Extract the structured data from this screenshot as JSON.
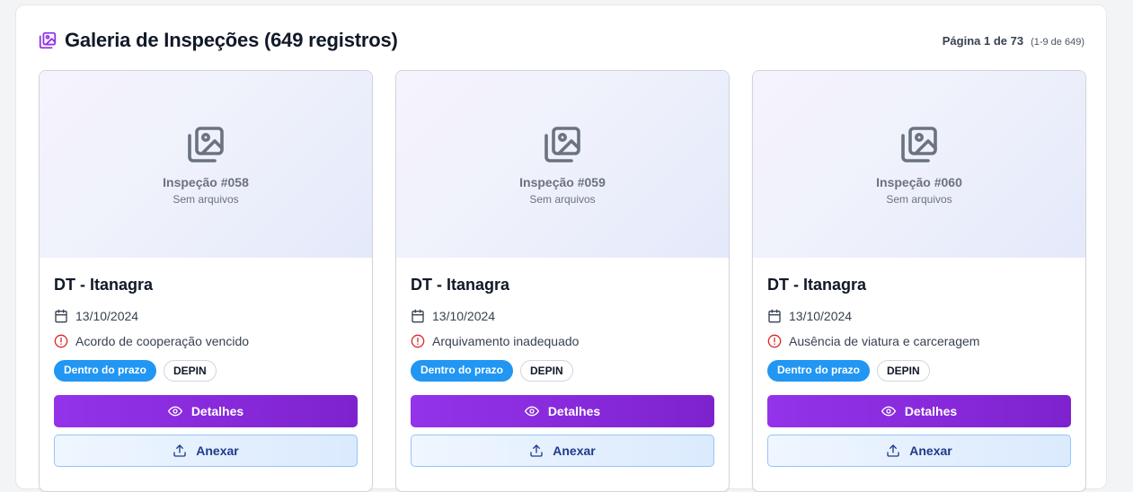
{
  "gallery": {
    "title": "Galeria de Inspeções (649 registros)",
    "title_icon": "image-gallery-icon",
    "page_label": "Página 1 de 73",
    "range_label": "(1-9 de 649)"
  },
  "cards": [
    {
      "thumb_title": "Inspeção #058",
      "thumb_subtitle": "Sem arquivos",
      "unit": "DT - Itanagra",
      "date": "13/10/2024",
      "issue": "Acordo de cooperação vencido",
      "status_badge": "Dentro do prazo",
      "org_badge": "DEPIN",
      "details_label": "Detalhes",
      "attach_label": "Anexar"
    },
    {
      "thumb_title": "Inspeção #059",
      "thumb_subtitle": "Sem arquivos",
      "unit": "DT - Itanagra",
      "date": "13/10/2024",
      "issue": "Arquivamento inadequado",
      "status_badge": "Dentro do prazo",
      "org_badge": "DEPIN",
      "details_label": "Detalhes",
      "attach_label": "Anexar"
    },
    {
      "thumb_title": "Inspeção #060",
      "thumb_subtitle": "Sem arquivos",
      "unit": "DT - Itanagra",
      "date": "13/10/2024",
      "issue": "Ausência de viatura e carceragem",
      "status_badge": "Dentro do prazo",
      "org_badge": "DEPIN",
      "details_label": "Detalhes",
      "attach_label": "Anexar"
    }
  ],
  "colors": {
    "accent_purple": "#9333ea",
    "status_blue": "#2196f3",
    "alert_red": "#dc2626"
  }
}
